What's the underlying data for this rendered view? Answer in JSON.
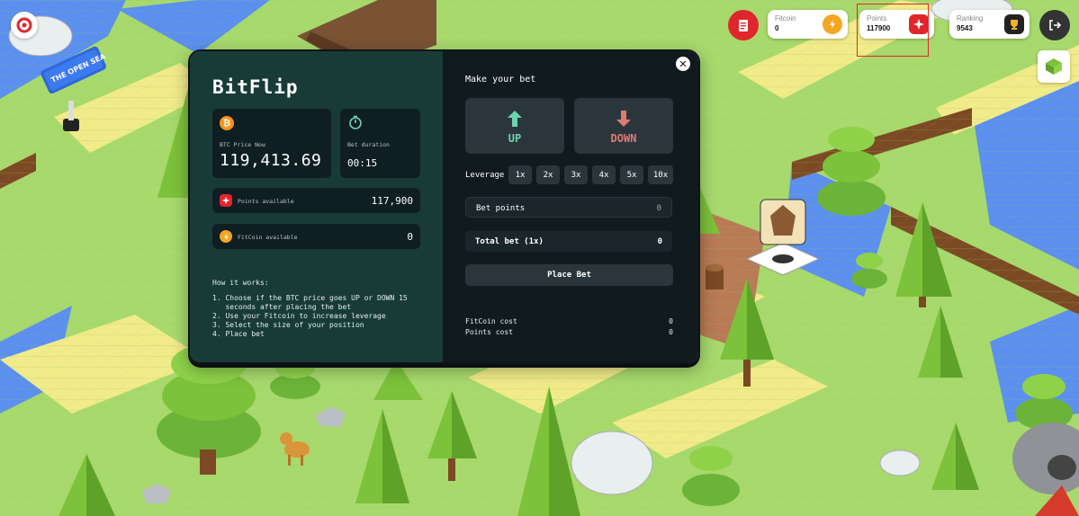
{
  "world": {
    "signpost_text": "THE OPEN SEA"
  },
  "hud": {
    "fitcoin": {
      "label": "Fitcoin",
      "value": "0"
    },
    "points": {
      "label": "Points",
      "value": "117900"
    },
    "ranking": {
      "label": "Ranking",
      "value": "9543"
    }
  },
  "modal": {
    "title": "BitFlip",
    "btc_price_label": "BTC Price Now",
    "btc_price": "119,413.69",
    "bet_duration_label": "Bet duration",
    "bet_duration": "00:15",
    "points_available_label": "Points available",
    "points_available": "117,900",
    "fitcoin_available_label": "FitCoin available",
    "fitcoin_available": "0",
    "how_title": "How it works:",
    "how_steps": [
      "1. Choose if the BTC price goes UP or DOWN 15",
      "   seconds after placing the bet",
      "2. Use your Fitcoin to increase leverage",
      "3. Select the size of your position",
      "4. Place bet"
    ],
    "make_bet": "Make your bet",
    "up_label": "UP",
    "down_label": "DOWN",
    "leverage_label": "Leverage",
    "leverage_options": [
      "1x",
      "2x",
      "3x",
      "4x",
      "5x",
      "10x"
    ],
    "bet_points_label": "Bet points",
    "bet_points_value": "0",
    "total_bet_label": "Total bet (1x)",
    "total_bet_value": "0",
    "place_bet_label": "Place Bet",
    "fitcoin_cost_label": "FitCoin cost",
    "fitcoin_cost_value": "0",
    "points_cost_label": "Points cost",
    "points_cost_value": "0",
    "colors": {
      "up": "#6fd3b0",
      "down": "#e07a75",
      "panel_left": "#183b37",
      "panel_right": "#111a1f"
    }
  }
}
